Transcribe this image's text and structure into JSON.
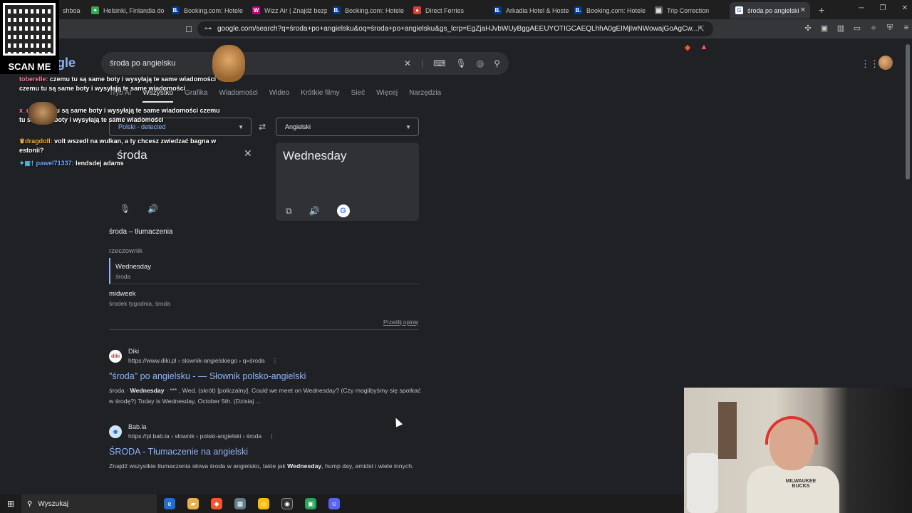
{
  "tabs": [
    {
      "label": "shboa",
      "color": "#3c4043",
      "glyph": ""
    },
    {
      "label": "Helsinki, Finlandia do",
      "color": "#34a853",
      "glyph": "⌖"
    },
    {
      "label": "Booking.com: Hotele",
      "color": "#003b95",
      "glyph": "B."
    },
    {
      "label": "Wizz Air | Znajdź bezp",
      "color": "#c6007e",
      "glyph": "W"
    },
    {
      "label": "Booking.com: Hotele",
      "color": "#003b95",
      "glyph": "B."
    },
    {
      "label": "Direct Ferries",
      "color": "#e53935",
      "glyph": "●"
    },
    {
      "label": "Arkadia Hotel & Hoste",
      "color": "#003b95",
      "glyph": "B."
    },
    {
      "label": "Booking.com: Hotele",
      "color": "#003b95",
      "glyph": "B."
    },
    {
      "label": "Trip Correction",
      "color": "#5f6368",
      "glyph": "▤"
    },
    {
      "label": "środa po angielski",
      "color": "#ffffff",
      "glyph": "G"
    }
  ],
  "address": {
    "url": "google.com/search?q=środa+po+angielsku&oq=środa+po+angielsku&gs_lcrp=EgZjaHJvbWUyBggAEEUYOTIGCAEQLhhA0gEIMjIwNWowajGoAgCw..."
  },
  "search": {
    "query": "środa po angielsku",
    "logo_text": "gle"
  },
  "nav": [
    "Tryb AI",
    "Wszystko",
    "Grafika",
    "Wiadomości",
    "Wideo",
    "Krótkie filmy",
    "Sieć",
    "Więcej",
    "Narzędzia"
  ],
  "nav_active": "Wszystko",
  "translate": {
    "source_lang": "Polski - detected",
    "target_lang": "Angielski",
    "source_text": "środa",
    "target_text": "Wednesday"
  },
  "dictionary": {
    "title": "środa – tłumaczenia",
    "pos": "rzeczownik",
    "entries": [
      {
        "word": "Wednesday",
        "sub": "środa"
      },
      {
        "word": "midweek",
        "sub": "środek tygodnia, środa"
      }
    ],
    "feedback": "Prześlij opinię"
  },
  "results": [
    {
      "site": "Diki",
      "url": "https://www.diki.pl › slownik-angielskiego › q=środa",
      "title": "\"środa\" po angielsku - — Słownik polsko-angielski",
      "snippet_a": "środa · ",
      "snippet_b": "Wednesday",
      "snippet_c": " · *** , Wed. (skrót) [policzalny]. Could we meet on Wednesday? (Czy moglibyśmy się spotkać w środę?) Today is Wednesday, October 5th. (Dzisiaj ..."
    },
    {
      "site": "Bab.la",
      "url": "https://pl.bab.la › slownik › polski-angielski › środa",
      "title": "ŚRODA - Tłumaczenie na angielski",
      "snippet_a": "Znajdź wszystkie tłumaczenia słowa środa w angielsko, takie jak ",
      "snippet_b": "Wednesday",
      "snippet_c": ", hump day, amidst i wiele innych."
    }
  ],
  "overlay": {
    "qr_label": "SCAN ME",
    "chat": [
      {
        "user": "toberelle:",
        "text": " czemu tu są same boty i wysyłają te same wiadomości czemu tu są same boty i wysyłają te same wiadomości"
      },
      {
        "user": "x_u",
        "text": " czemu tu są same boty i wysyłają te same wiadomości czemu tu są same boty i wysyłają te same wiadomości"
      },
      {
        "user": "dragdoll:",
        "text": " volt wszedł na wulkan, a ty chcesz zwiedzać bagna w estonii?"
      },
      {
        "user": "pawel71337:",
        "text": " lendsdej adams"
      }
    ]
  },
  "webcam": {
    "shirt_text": "MILWAUKEE BUCKS"
  },
  "taskbar": {
    "search_placeholder": "Wyszukaj"
  }
}
